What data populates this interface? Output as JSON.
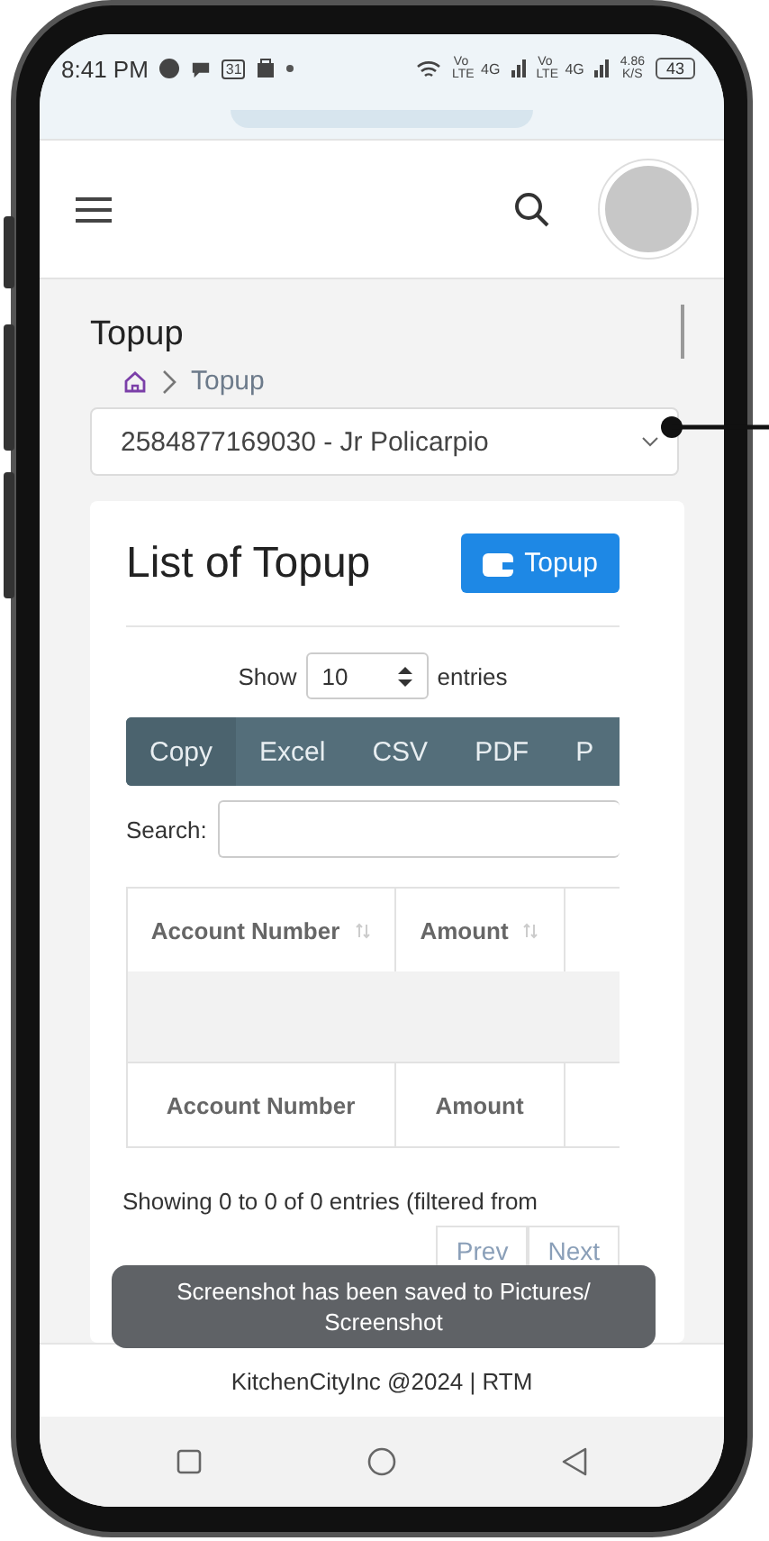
{
  "status_bar": {
    "time": "8:41 PM",
    "calendar_day": "31",
    "signals": [
      {
        "label": "Vo LTE",
        "tech": "4G"
      },
      {
        "label": "Vo LTE",
        "tech": "4G"
      }
    ],
    "speed": "4.86",
    "speed_unit": "K/S",
    "battery": "43"
  },
  "page": {
    "title": "Topup",
    "breadcrumb": [
      "Topup"
    ]
  },
  "account_select": {
    "value": "2584877169030 - Jr Policarpio"
  },
  "card": {
    "title": "List of Topup",
    "add_button": "Topup",
    "length": {
      "prefix": "Show",
      "value": "10",
      "suffix": "entries"
    },
    "export_buttons": [
      "Copy",
      "Excel",
      "CSV",
      "PDF",
      "P"
    ],
    "search_label": "Search:",
    "columns": [
      "Account Number",
      "Amount"
    ],
    "footer_columns": [
      "Account Number",
      "Amount"
    ],
    "info": "Showing 0 to 0 of 0 entries (filtered from",
    "pagination": [
      "Prev",
      "Next"
    ]
  },
  "footer": "KitchenCityInc @2024 | RTM",
  "toast": "Screenshot has been saved to  Pictures/ Screenshot"
}
